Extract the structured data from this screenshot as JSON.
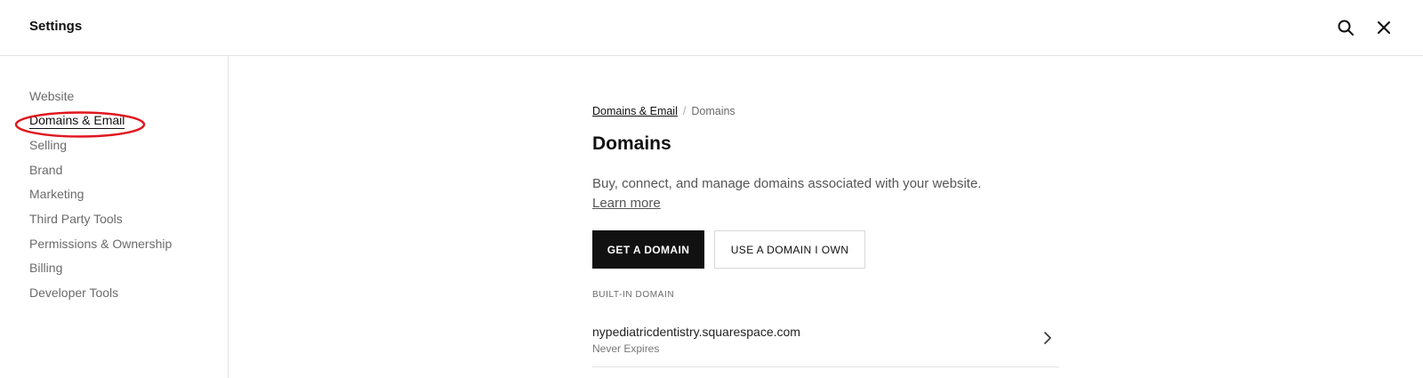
{
  "header": {
    "title": "Settings",
    "search_icon": "search-icon",
    "close_icon": "close-icon"
  },
  "sidebar": {
    "items": [
      {
        "label": "Website",
        "active": false
      },
      {
        "label": "Domains & Email",
        "active": true
      },
      {
        "label": "Selling",
        "active": false
      },
      {
        "label": "Brand",
        "active": false
      },
      {
        "label": "Marketing",
        "active": false
      },
      {
        "label": "Third Party Tools",
        "active": false
      },
      {
        "label": "Permissions & Ownership",
        "active": false
      },
      {
        "label": "Billing",
        "active": false
      },
      {
        "label": "Developer Tools",
        "active": false
      }
    ],
    "annotation_color": "#e0161e"
  },
  "breadcrumb": {
    "parent": "Domains & Email",
    "separator": "/",
    "current": "Domains"
  },
  "main": {
    "title": "Domains",
    "description": "Buy, connect, and manage domains associated with your website.",
    "learn_more": "Learn more",
    "get_domain_button": "GET A DOMAIN",
    "use_domain_button": "USE A DOMAIN I OWN",
    "section_label": "BUILT-IN DOMAIN",
    "domain": {
      "name": "nypediatricdentistry.squarespace.com",
      "status": "Never Expires",
      "chevron_icon": "chevron-right-icon"
    }
  }
}
